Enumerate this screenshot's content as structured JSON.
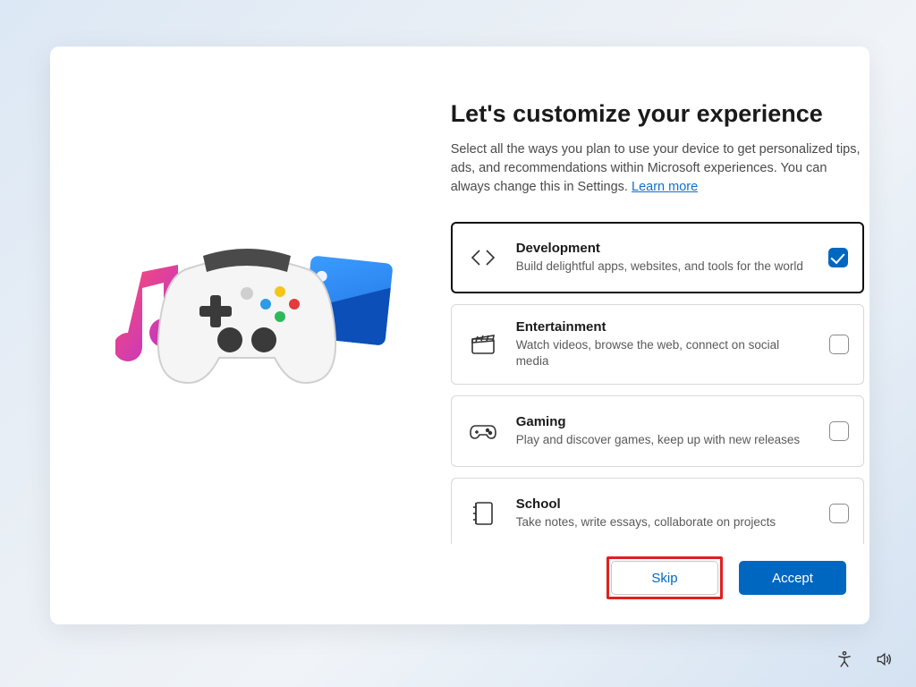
{
  "heading": "Let's customize your experience",
  "subtitle_prefix": "Select all the ways you plan to use your device to get personalized tips, ads, and recommendations within Microsoft experiences. You can always change this in Settings. ",
  "learn_more": "Learn more",
  "options": [
    {
      "title": "Development",
      "desc": "Build delightful apps, websites, and tools for the world",
      "checked": true
    },
    {
      "title": "Entertainment",
      "desc": "Watch videos, browse the web, connect on social media",
      "checked": false
    },
    {
      "title": "Gaming",
      "desc": "Play and discover games, keep up with new releases",
      "checked": false
    },
    {
      "title": "School",
      "desc": "Take notes, write essays, collaborate on projects",
      "checked": false
    }
  ],
  "buttons": {
    "skip": "Skip",
    "accept": "Accept"
  },
  "colors": {
    "accent": "#0067c0",
    "highlight_border": "#e02020"
  }
}
